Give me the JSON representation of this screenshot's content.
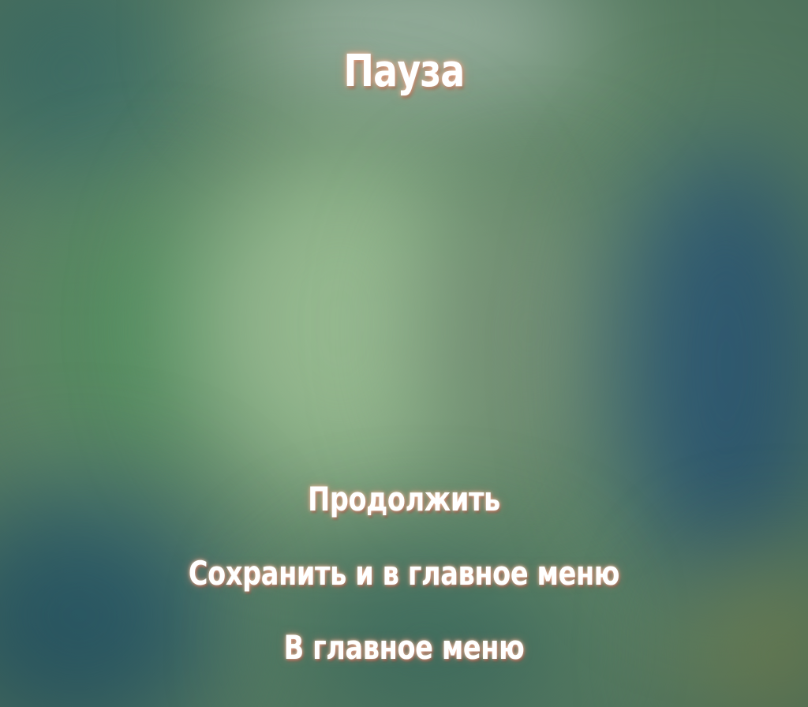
{
  "pause_menu": {
    "title": "Пауза",
    "items": [
      {
        "label": "Продолжить"
      },
      {
        "label": "Сохранить и в главное меню"
      },
      {
        "label": "В главное меню"
      }
    ]
  }
}
